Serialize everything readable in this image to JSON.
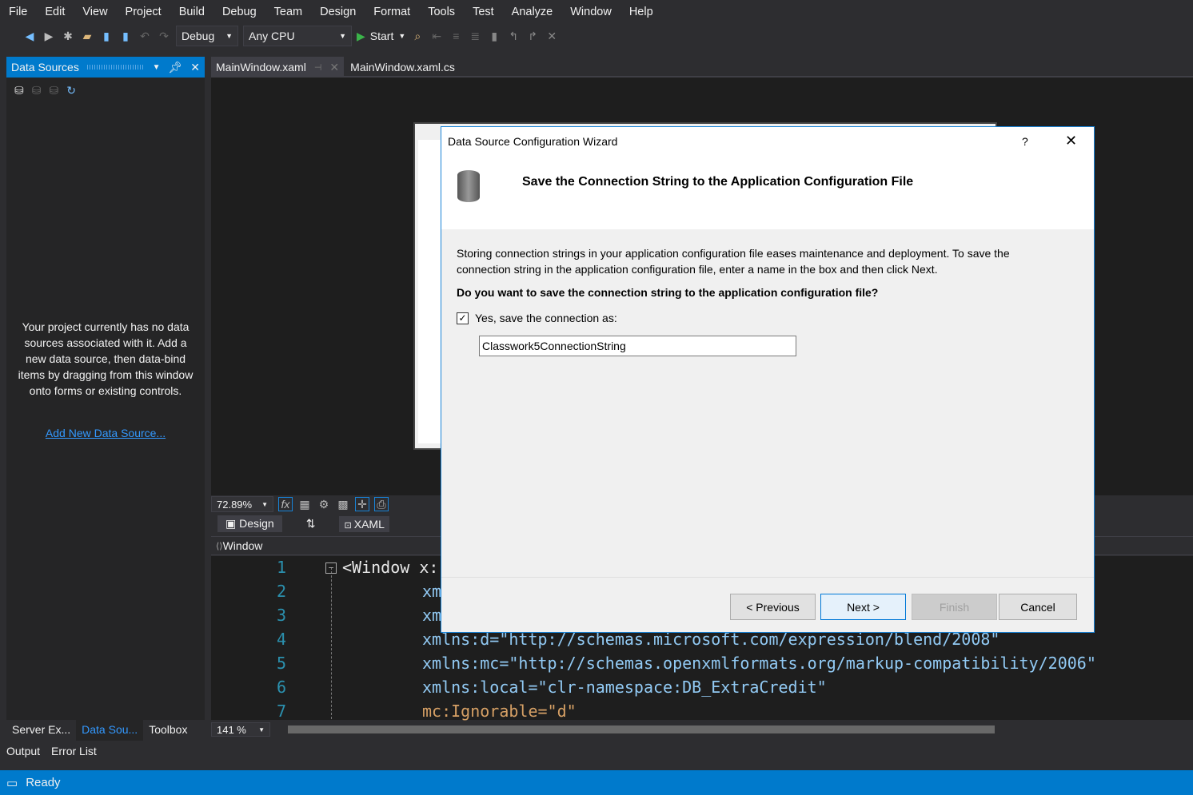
{
  "menu": [
    "File",
    "Edit",
    "View",
    "Project",
    "Build",
    "Debug",
    "Team",
    "Design",
    "Format",
    "Tools",
    "Test",
    "Analyze",
    "Window",
    "Help"
  ],
  "toolbar": {
    "config": "Debug",
    "platform": "Any CPU",
    "start": "Start"
  },
  "panel": {
    "title": "Data Sources",
    "message": "Your project currently has no data sources associated with it. Add a new data source, then data-bind items by dragging from this window onto forms or existing controls.",
    "link": "Add New Data Source...",
    "bottom_tabs": [
      "Server Ex...",
      "Data Sou...",
      "Toolbox"
    ]
  },
  "tabs": [
    "MainWindow.xaml",
    "MainWindow.xaml.cs"
  ],
  "designer": {
    "zoom": "72.89%",
    "design_tab": "Design",
    "xaml_tab": "XAML",
    "breadcrumb": "Window",
    "editor_zoom": "141 %"
  },
  "code": [
    {
      "n": "1",
      "t": "<Window x:"
    },
    {
      "n": "2",
      "t": "xm"
    },
    {
      "n": "3",
      "t": "xm"
    },
    {
      "n": "4",
      "t": "xmlns:d=\"http://schemas.microsoft.com/expression/blend/2008\""
    },
    {
      "n": "5",
      "t": "xmlns:mc=\"http://schemas.openxmlformats.org/markup-compatibility/2006\""
    },
    {
      "n": "6",
      "t": "xmlns:local=\"clr-namespace:DB_ExtraCredit\""
    },
    {
      "n": "7",
      "t": "mc:Ignorable=\"d\""
    }
  ],
  "bottom_panel_tabs": [
    "Output",
    "Error List"
  ],
  "status": "Ready",
  "dialog": {
    "title": "Data Source Configuration Wizard",
    "help": "?",
    "heading": "Save the Connection String to the Application Configuration File",
    "description": "Storing connection strings in your application configuration file eases maintenance and deployment. To save the connection string in the application configuration file, enter a name in the box and then click Next.",
    "question": "Do you want to save the connection string to the application configuration file?",
    "checkbox_label": "Yes, save the connection as:",
    "checkbox_checked": true,
    "connection_name": "Classwork5ConnectionString",
    "buttons": {
      "previous": "< Previous",
      "next": "Next >",
      "finish": "Finish",
      "cancel": "Cancel"
    }
  }
}
